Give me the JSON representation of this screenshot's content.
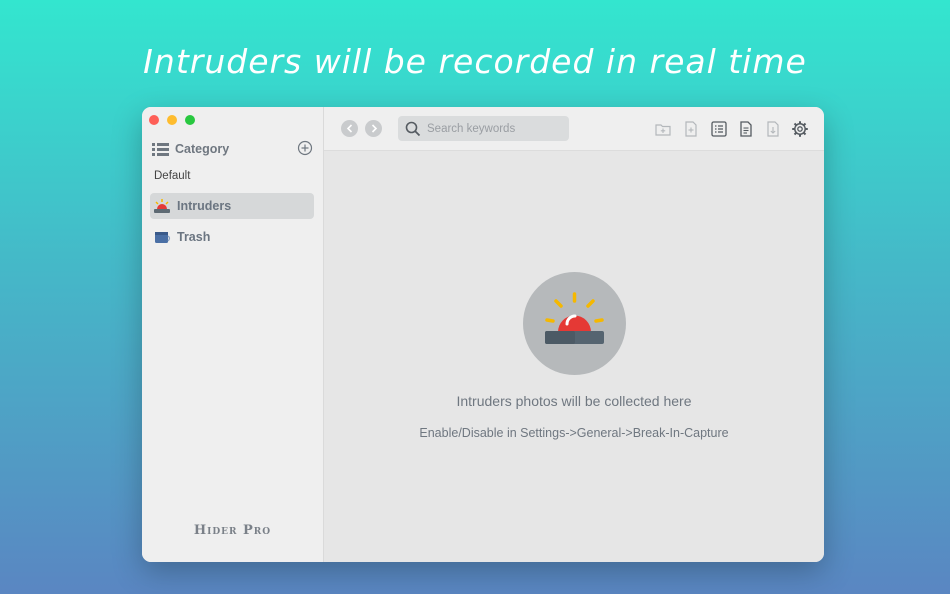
{
  "headline": "Intruders will be recorded in real time",
  "sidebar": {
    "category_title": "Category",
    "section_label": "Default",
    "items": [
      {
        "label": "Intruders",
        "icon": "alarm-icon",
        "active": true
      },
      {
        "label": "Trash",
        "icon": "trash-icon",
        "active": false
      }
    ],
    "brand": "Hider Pro"
  },
  "toolbar": {
    "search_placeholder": "Search keywords",
    "icons": [
      "back-icon",
      "forward-icon",
      "new-folder-icon",
      "new-file-icon",
      "list-icon",
      "note-icon",
      "import-icon",
      "gear-icon"
    ]
  },
  "empty_state": {
    "title": "Intruders photos will be collected here",
    "subtitle": "Enable/Disable in Settings->General->Break-In-Capture"
  },
  "colors": {
    "bg_top": "#33e6cf",
    "bg_bottom": "#5a86c2",
    "alarm_red": "#e53935",
    "alarm_ray": "#f5b800"
  }
}
